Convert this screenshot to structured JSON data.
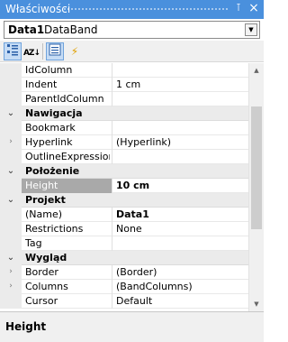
{
  "window": {
    "title": "Właściwości",
    "pin_glyph": "⊺",
    "close_glyph": "×"
  },
  "object_selector": {
    "name": "Data1",
    "type": "DataBand",
    "dropdown_glyph": "▼"
  },
  "toolbar": {
    "categorized_icon": "categorized-icon",
    "alphabetical_icon": "sort-az-icon",
    "alphabetical_text": "AZ↓",
    "properties_icon": "properties-icon",
    "events_icon": "lightning-icon",
    "events_glyph": "⚡"
  },
  "grid": {
    "rows": [
      {
        "kind": "prop",
        "name": "IdColumn",
        "value": ""
      },
      {
        "kind": "prop",
        "name": "Indent",
        "value": "1 cm"
      },
      {
        "kind": "prop",
        "name": "ParentIdColumn",
        "value": ""
      },
      {
        "kind": "cat",
        "name": "Nawigacja",
        "glyph": "⌄"
      },
      {
        "kind": "prop",
        "name": "Bookmark",
        "value": ""
      },
      {
        "kind": "prop",
        "name": "Hyperlink",
        "value": "(Hyperlink)",
        "expand": "›"
      },
      {
        "kind": "prop",
        "name": "OutlineExpression",
        "value": ""
      },
      {
        "kind": "cat",
        "name": "Położenie",
        "glyph": "⌄"
      },
      {
        "kind": "prop",
        "name": "Height",
        "value": "10 cm",
        "selected": true
      },
      {
        "kind": "cat",
        "name": "Projekt",
        "glyph": "⌄"
      },
      {
        "kind": "prop",
        "name": "(Name)",
        "value": "Data1",
        "bold_value": true
      },
      {
        "kind": "prop",
        "name": "Restrictions",
        "value": "None"
      },
      {
        "kind": "prop",
        "name": "Tag",
        "value": ""
      },
      {
        "kind": "cat",
        "name": "Wygląd",
        "glyph": "⌄"
      },
      {
        "kind": "prop",
        "name": "Border",
        "value": "(Border)",
        "expand": "›"
      },
      {
        "kind": "prop",
        "name": "Columns",
        "value": "(BandColumns)",
        "expand": "›"
      },
      {
        "kind": "prop",
        "name": "Cursor",
        "value": "Default"
      }
    ]
  },
  "scrollbar": {
    "up_glyph": "▲",
    "down_glyph": "▼"
  },
  "help": {
    "title": "Height"
  }
}
